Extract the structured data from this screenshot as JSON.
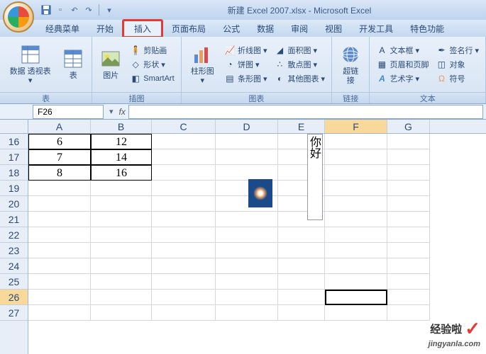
{
  "title": "新建 Excel 2007.xlsx - Microsoft Excel",
  "qat": {
    "save": "💾",
    "undo": "↶",
    "redo": "↷"
  },
  "tabs": {
    "classic": "经典菜单",
    "home": "开始",
    "insert": "插入",
    "layout": "页面布局",
    "formula": "公式",
    "data": "数据",
    "review": "审阅",
    "view": "视图",
    "dev": "开发工具",
    "special": "特色功能"
  },
  "ribbon": {
    "tables": {
      "label": "表",
      "pivot": "数据\n透视表",
      "table": "表"
    },
    "illust": {
      "label": "插图",
      "picture": "图片",
      "clipart": "剪贴画",
      "shapes": "形状",
      "smartart": "SmartArt"
    },
    "charts": {
      "label": "图表",
      "column": "柱形图",
      "line": "折线图",
      "pie": "饼图",
      "bar": "条形图",
      "area": "面积图",
      "scatter": "散点图",
      "other": "其他图表"
    },
    "links": {
      "label": "链接",
      "hyperlink": "超链接"
    },
    "text": {
      "label": "文本",
      "textbox": "文本框",
      "headerfooter": "页眉和页脚",
      "wordart": "艺术字",
      "sigline": "签名行",
      "object": "对象",
      "symbol": "符号"
    }
  },
  "namebox": "F26",
  "columns": [
    "A",
    "B",
    "C",
    "D",
    "E",
    "F",
    "G"
  ],
  "rows": [
    "16",
    "17",
    "18",
    "19",
    "20",
    "21",
    "22",
    "23",
    "24",
    "25",
    "26",
    "27"
  ],
  "cells": {
    "A16": "6",
    "B16": "12",
    "A17": "7",
    "B17": "14",
    "A18": "8",
    "B18": "16"
  },
  "vert_text": "你好",
  "active_cell": {
    "row": "26",
    "col": "F"
  },
  "watermark": {
    "text": "经验啦",
    "url": "jingyanla.com"
  }
}
